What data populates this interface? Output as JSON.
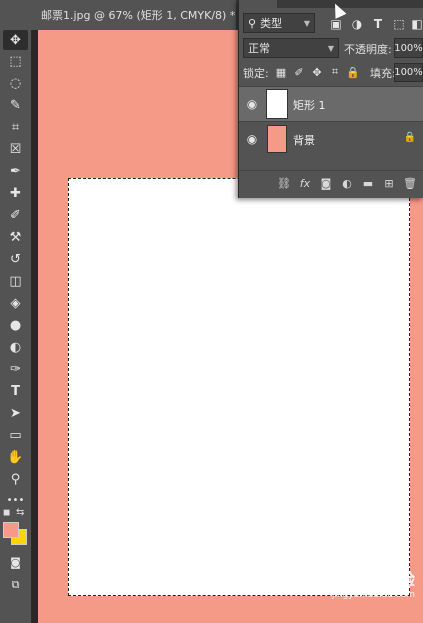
{
  "document_tab": {
    "title": "邮票1.jpg @ 67% (矩形 1, CMYK/8) *",
    "close": "×"
  },
  "toolbar": {
    "tools": [
      {
        "name": "move-tool-icon",
        "glyph": "✥"
      },
      {
        "name": "marquee-tool-icon",
        "glyph": "⬚"
      },
      {
        "name": "lasso-tool-icon",
        "glyph": "◌"
      },
      {
        "name": "quick-select-tool-icon",
        "glyph": "✎"
      },
      {
        "name": "crop-tool-icon",
        "glyph": "⌗"
      },
      {
        "name": "frame-tool-icon",
        "glyph": "☒"
      },
      {
        "name": "eyedropper-tool-icon",
        "glyph": "✒"
      },
      {
        "name": "healing-brush-tool-icon",
        "glyph": "✚"
      },
      {
        "name": "brush-tool-icon",
        "glyph": "✐"
      },
      {
        "name": "stamp-tool-icon",
        "glyph": "⚒"
      },
      {
        "name": "history-brush-tool-icon",
        "glyph": "↺"
      },
      {
        "name": "eraser-tool-icon",
        "glyph": "◫"
      },
      {
        "name": "paint-bucket-tool-icon",
        "glyph": "◈"
      },
      {
        "name": "blur-tool-icon",
        "glyph": "●"
      },
      {
        "name": "dodge-tool-icon",
        "glyph": "◐"
      },
      {
        "name": "pen-tool-icon",
        "glyph": "✑"
      },
      {
        "name": "type-tool-icon",
        "glyph": "T"
      },
      {
        "name": "path-select-tool-icon",
        "glyph": "➤"
      },
      {
        "name": "rectangle-tool-icon",
        "glyph": "▭"
      },
      {
        "name": "hand-tool-icon",
        "glyph": "✋"
      },
      {
        "name": "zoom-tool-icon",
        "glyph": "⚲"
      },
      {
        "name": "more-tools-icon",
        "glyph": "•••"
      }
    ],
    "foreground_color": "#f59a87",
    "background_color": "#ffd600"
  },
  "layers_panel": {
    "filter_kind": "类型",
    "blend_mode": "正常",
    "opacity_label": "不透明度:",
    "opacity_value": "100%",
    "lock_label": "锁定:",
    "fill_label": "填充:",
    "fill_value": "100%",
    "layers": [
      {
        "name": "矩形 1",
        "selected": true,
        "thumb_color": "#ffffff"
      },
      {
        "name": "背景",
        "selected": false,
        "thumb_color": "#f59a87",
        "locked": true
      }
    ]
  },
  "canvas": {
    "background_color": "#f59a87",
    "shape_color": "#ffffff"
  },
  "watermark": {
    "line1": "Bai 经验",
    "line2": "jingyan.baidu.com"
  }
}
